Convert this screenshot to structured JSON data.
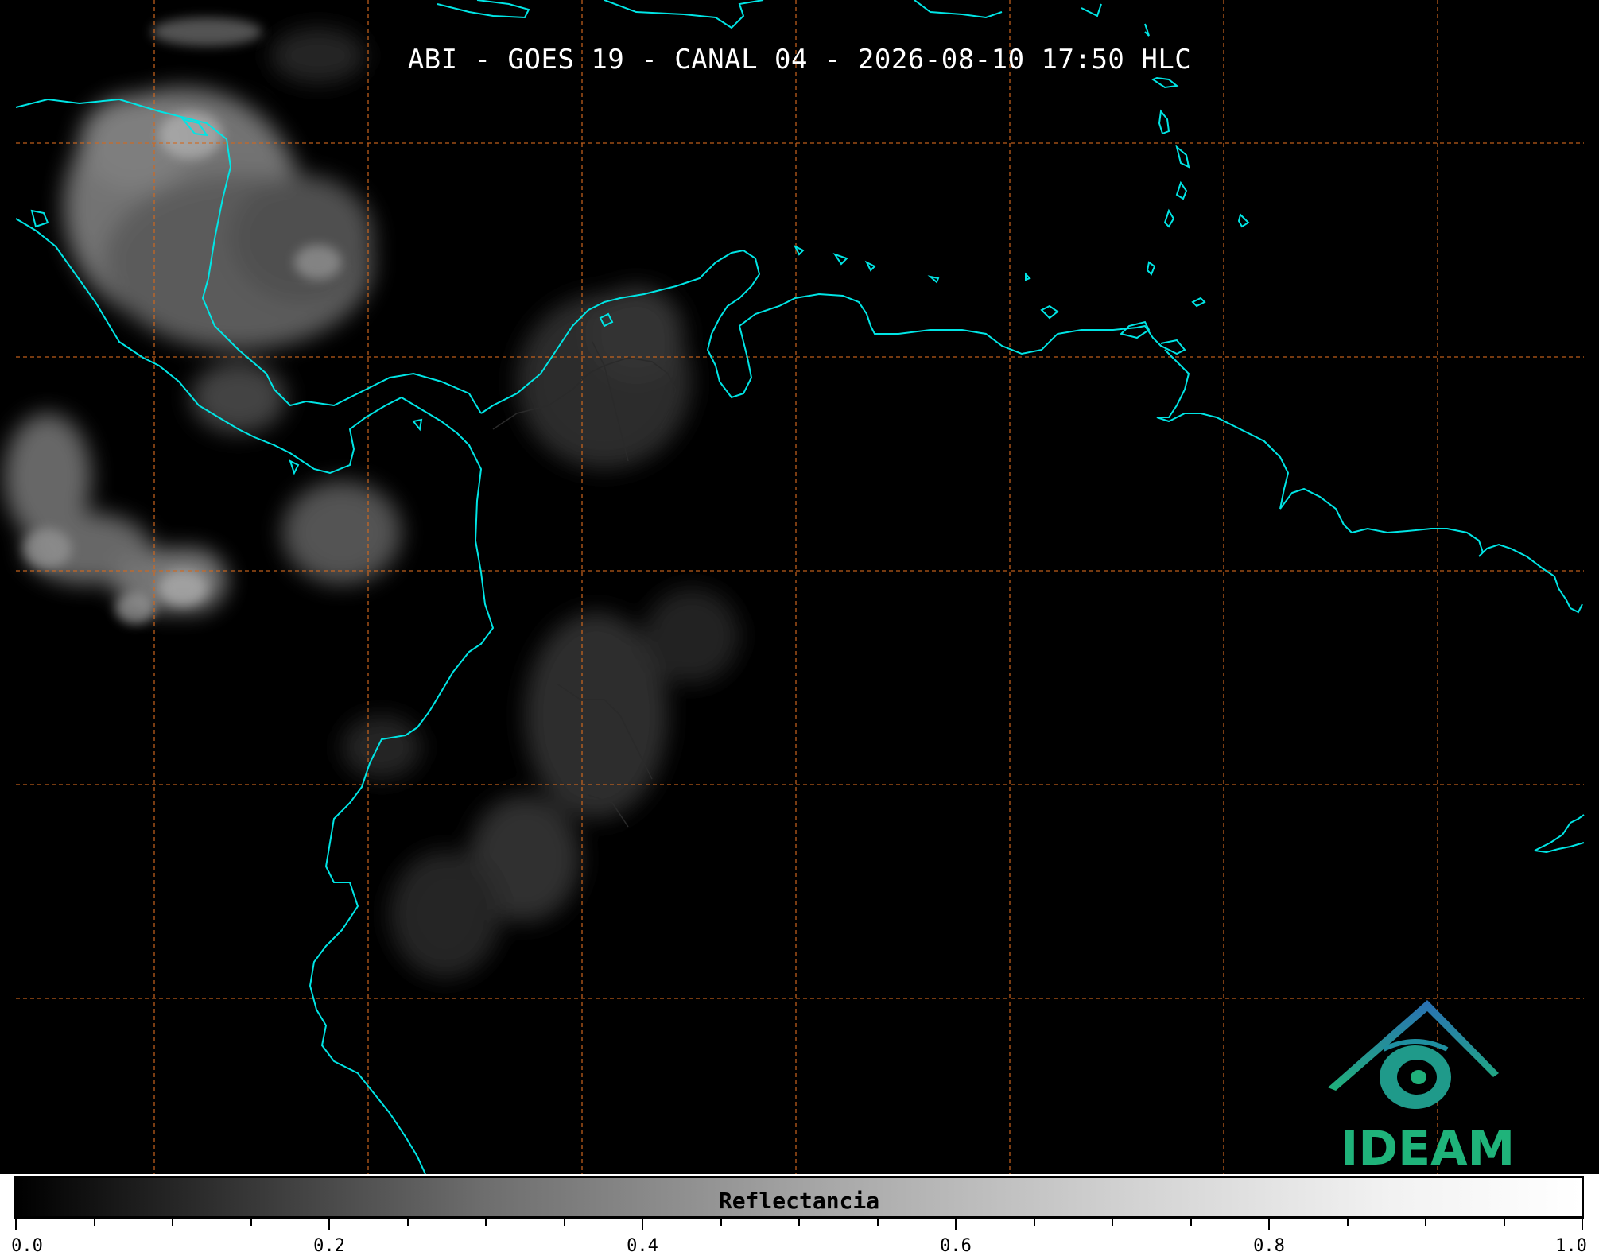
{
  "title": "ABI - GOES 19 - CANAL 04 - 2026-08-10 17:50 HLC",
  "logo": {
    "text": "IDEAM",
    "colors": {
      "text": "#1fb37a",
      "mark_top": "#2a6fb5",
      "mark_bottom": "#20b07a"
    }
  },
  "map": {
    "background": "#000000",
    "coastline_color": "#00e5e5",
    "grid_color": "#d2691e",
    "grid_style": "dashed",
    "cloud_color": "#8a8a8a"
  },
  "colorbar": {
    "label": "Reflectancia",
    "range": [
      0.0,
      1.0
    ],
    "tick_labels": [
      "0.0",
      "0.2",
      "0.4",
      "0.6",
      "0.8",
      "1.0"
    ],
    "colormap": "grayscale"
  }
}
